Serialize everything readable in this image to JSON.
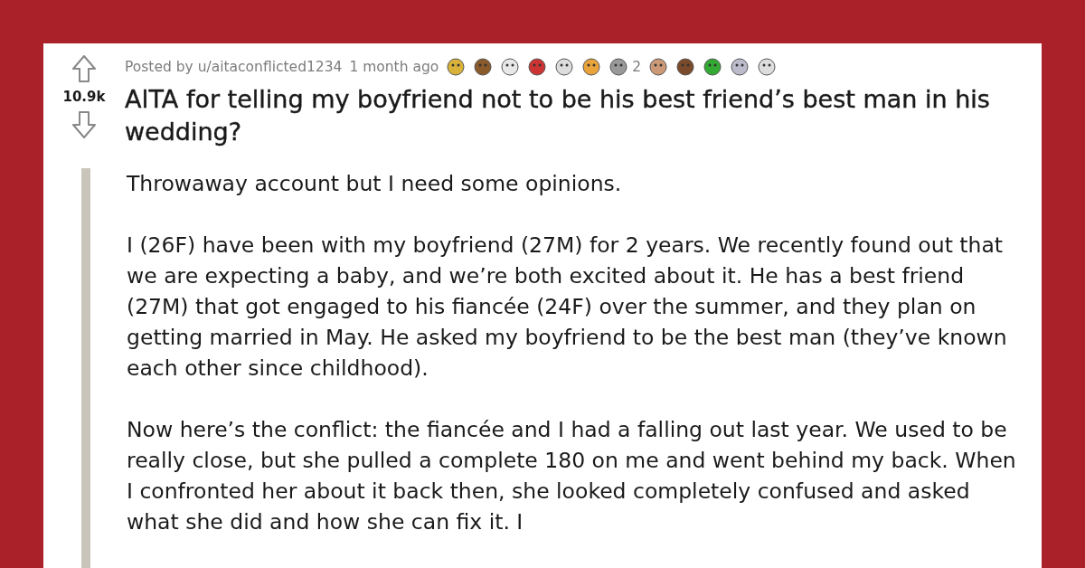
{
  "post": {
    "posted_by": "Posted by u/aitaconflicted1234",
    "time": "1 month ago",
    "award_count": "2",
    "score": "10.9k",
    "title": "AITA for telling my boyfriend not to be his best friend’s best man in his wedding?",
    "paragraphs": [
      "Throwaway account but I need some opinions.",
      "I (26F) have been with my boyfriend (27M) for 2 years. We recently found out that we are expecting a baby, and we’re both excited about it. He has a best friend (27M) that got engaged to his fiancée (24F) over the summer, and they plan on getting married in May. He asked my boyfriend to be the best man (they’ve known each other since childhood).",
      "Now here’s the conflict: the fiancée and I had a falling out last year. We used to be really close, but she pulled a complete 180 on me and went behind my back. When I confronted her about it back then, she looked completely confused and asked what she did and how she can fix it. I"
    ]
  }
}
